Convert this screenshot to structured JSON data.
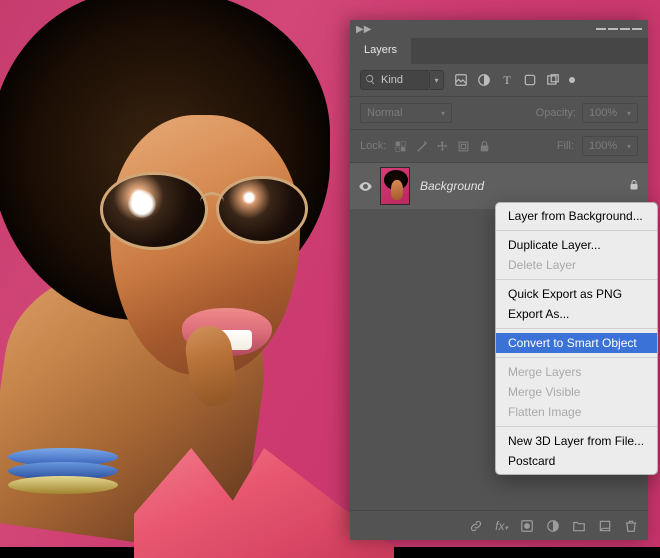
{
  "panel": {
    "title": "Layers",
    "filter": {
      "search_value": "Kind",
      "search_placeholder": "Kind"
    },
    "blend": {
      "mode": "Normal",
      "opacity_label": "Opacity:",
      "opacity_value": "100%"
    },
    "lock": {
      "label": "Lock:",
      "fill_label": "Fill:",
      "fill_value": "100%"
    },
    "layer": {
      "name": "Background"
    }
  },
  "context_menu": {
    "items": [
      {
        "label": "Layer from Background...",
        "enabled": true
      },
      {
        "sep": true
      },
      {
        "label": "Duplicate Layer...",
        "enabled": true
      },
      {
        "label": "Delete Layer",
        "enabled": false
      },
      {
        "sep": true
      },
      {
        "label": "Quick Export as PNG",
        "enabled": true
      },
      {
        "label": "Export As...",
        "enabled": true
      },
      {
        "sep": true
      },
      {
        "label": "Convert to Smart Object",
        "enabled": true,
        "selected": true
      },
      {
        "sep": true
      },
      {
        "label": "Merge Layers",
        "enabled": false
      },
      {
        "label": "Merge Visible",
        "enabled": false
      },
      {
        "label": "Flatten Image",
        "enabled": false
      },
      {
        "sep": true
      },
      {
        "label": "New 3D Layer from File...",
        "enabled": true
      },
      {
        "label": "Postcard",
        "enabled": true
      }
    ]
  }
}
